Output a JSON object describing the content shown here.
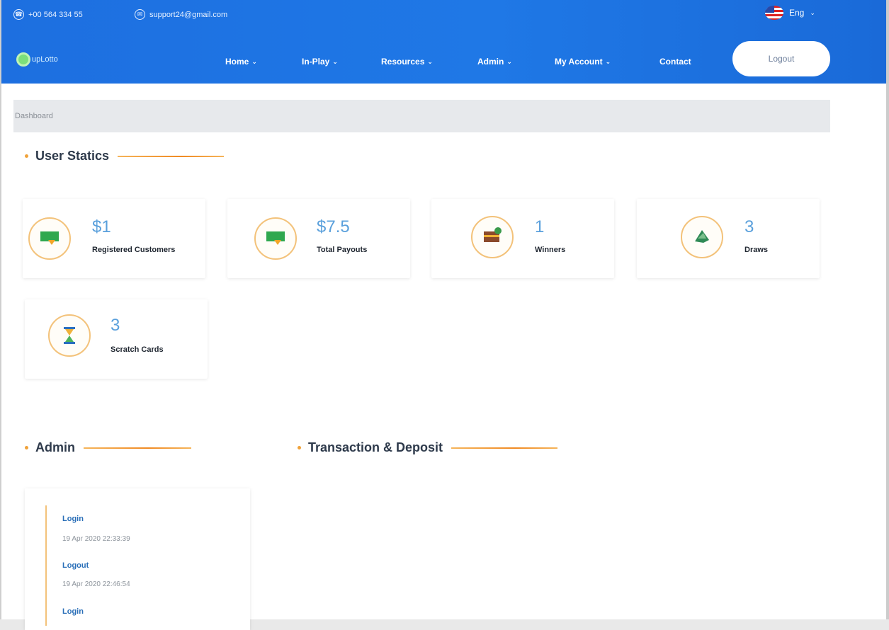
{
  "topbar": {
    "phone": "+00 564 334 55",
    "email": "support24@gmail.com",
    "language": "Eng",
    "logo_text": "upLotto",
    "nav": [
      "Home",
      "In-Play",
      "Resources",
      "Admin",
      "My Account",
      "Contact"
    ],
    "logout_label": "Logout"
  },
  "breadcrumb": "Dashboard",
  "sections": {
    "user_statics": "User Statics",
    "admin": "Admin",
    "transactions": "Transaction & Deposit"
  },
  "stats": [
    {
      "value": "$1",
      "label": "Registered Customers",
      "icon": "money-icon"
    },
    {
      "value": "$7.5",
      "label": "Total Payouts",
      "icon": "money-icon"
    },
    {
      "value": "1",
      "label": "Winners",
      "icon": "treasure-chest-icon"
    },
    {
      "value": "3",
      "label": "Draws",
      "icon": "clover-icon"
    },
    {
      "value": "3",
      "label": "Scratch Cards",
      "icon": "hourglass-icon"
    }
  ],
  "admin_log": [
    {
      "action": "Login",
      "time": "19 Apr 2020 22:33:39"
    },
    {
      "action": "Logout",
      "time": "19 Apr 2020 22:46:54"
    },
    {
      "action": "Login",
      "time": ""
    }
  ],
  "colors": {
    "primary": "#1f78e6",
    "accent_orange": "#f08a23",
    "stat_value": "#5aa0dc"
  }
}
